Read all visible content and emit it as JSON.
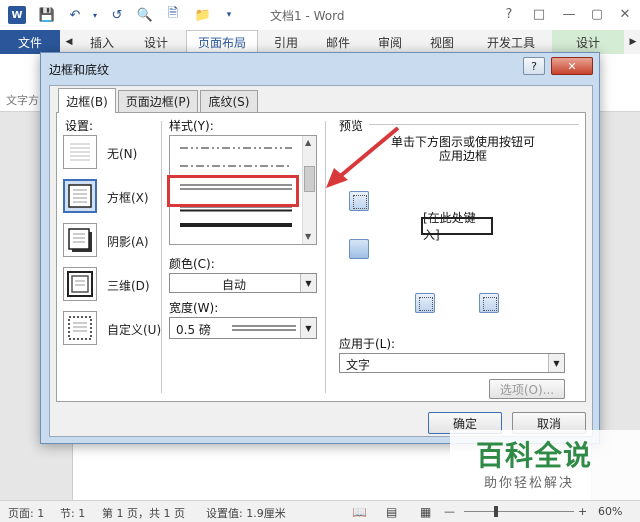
{
  "window": {
    "title": "文档1 - Word"
  },
  "ribbon": {
    "tabs": [
      "文件",
      "插入",
      "设计",
      "页面布局",
      "引用",
      "邮件",
      "审阅",
      "视图",
      "开发工具",
      "设计"
    ],
    "active": "页面布局",
    "group_label": "文字方"
  },
  "dialog": {
    "title": "边框和底纹",
    "help": "?",
    "close": "✕",
    "tabs": [
      "边框(B)",
      "页面边框(P)",
      "底纹(S)"
    ],
    "settings_label": "设置:",
    "settings": [
      "无(N)",
      "方框(X)",
      "阴影(A)",
      "三维(D)",
      "自定义(U)"
    ],
    "style_label": "样式(Y):",
    "color_label": "颜色(C):",
    "color_value": "自动",
    "width_label": "宽度(W):",
    "width_value": "0.5 磅",
    "preview_label": "预览",
    "preview_hint_1": "单击下方图示或使用按钮可",
    "preview_hint_2": "应用边框",
    "sample_text": "[在此处键入]",
    "apply_label": "应用于(L):",
    "apply_value": "文字",
    "options_btn": "选项(O)...",
    "ok_btn": "确定",
    "cancel_btn": "取消"
  },
  "status": {
    "page": "页面: 1",
    "section": "节: 1",
    "pages": "第 1 页，共 1 页",
    "position": "设置值: 1.9厘米",
    "zoom": "60%"
  },
  "watermark": {
    "main": "百科全说",
    "sub": "助你轻松解决"
  },
  "colors": {
    "accent": "#2b579a",
    "highlight": "#d9383a",
    "watermark": "#2e8a45"
  }
}
